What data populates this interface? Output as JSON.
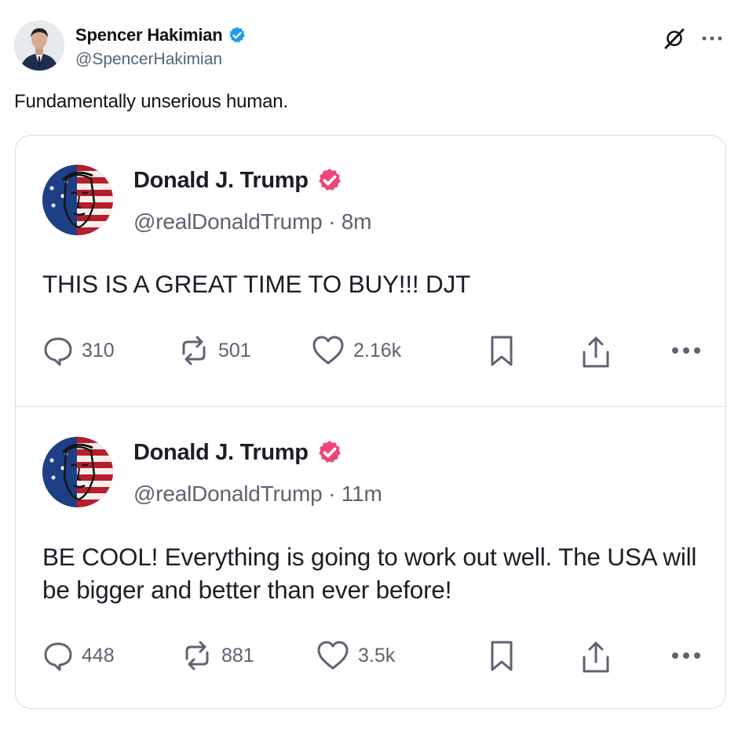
{
  "outer": {
    "name": "Spencer Hakimian",
    "handle": "@SpencerHakimian",
    "text": "Fundamentally unserious human.",
    "verified_color": "#1d9bf0"
  },
  "embedded_posts": [
    {
      "name": "Donald J. Trump",
      "handle_time": "@realDonaldTrump · 8m",
      "text": "THIS IS A GREAT TIME TO BUY!!! DJT",
      "replies": "310",
      "reposts": "501",
      "likes": "2.16k"
    },
    {
      "name": "Donald J. Trump",
      "handle_time": "@realDonaldTrump · 11m",
      "text": "BE COOL! Everything is going to work out well. The USA will be bigger and better than ever before!",
      "replies": "448",
      "reposts": "881",
      "likes": "3.5k"
    }
  ],
  "colors": {
    "truth_badge": "#f0457a",
    "text_primary": "#1c1d26",
    "text_secondary": "#5f6370"
  },
  "icons": [
    "verified-badge-icon",
    "grok-icon",
    "more-icon",
    "reply-icon",
    "repost-icon",
    "like-icon",
    "bookmark-icon",
    "share-icon"
  ]
}
